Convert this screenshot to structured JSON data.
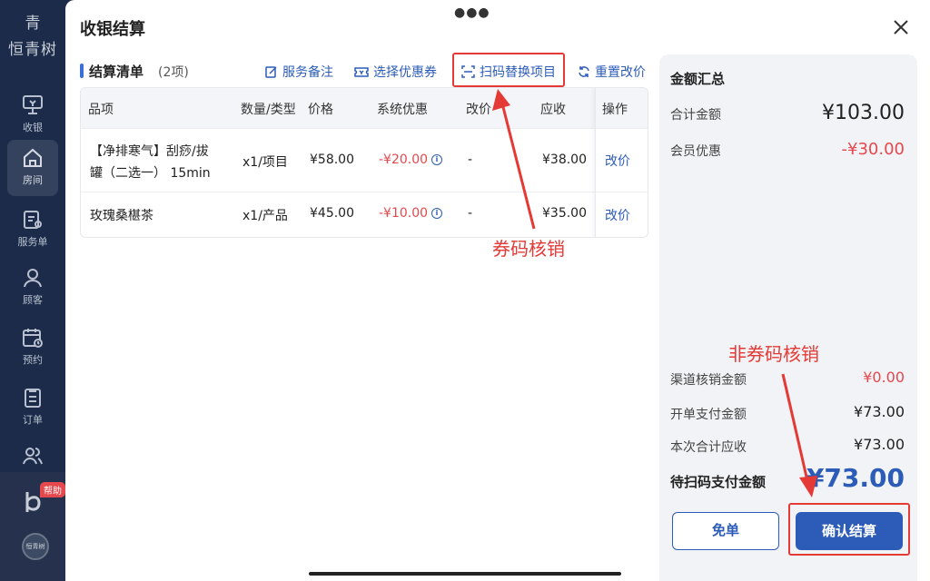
{
  "app": {
    "logo_mark": "青",
    "logo_text": "恒青树",
    "bottom_logo_text": "恒青树"
  },
  "sidebar": {
    "items": [
      {
        "label": "收银",
        "icon": "cashier-icon",
        "active": false
      },
      {
        "label": "房间",
        "icon": "home-icon",
        "active": true
      },
      {
        "label": "服务单",
        "icon": "service-order-icon",
        "active": false
      },
      {
        "label": "顾客",
        "icon": "customer-icon",
        "active": false
      },
      {
        "label": "预约",
        "icon": "calendar-icon",
        "active": false
      },
      {
        "label": "订单",
        "icon": "order-icon",
        "active": false
      },
      {
        "label": "",
        "icon": "users-icon",
        "active": false
      }
    ],
    "help_badge": "帮助"
  },
  "dialog": {
    "title": "收银结算"
  },
  "list": {
    "title": "结算清单",
    "count": "(2项)",
    "actions": {
      "remark": "服务备注",
      "coupon": "选择优惠券",
      "scan": "扫码替换项目",
      "reset": "重置改价"
    },
    "headers": [
      "品项",
      "数量/类型",
      "价格",
      "系统优惠",
      "改价",
      "应收",
      "操作"
    ],
    "rows": [
      {
        "name_line1": "【净排寒气】刮痧/拔",
        "name_line2": "罐（二选一） 15min",
        "qty": "x1/项目",
        "price": "¥58.00",
        "discount": "-¥20.00",
        "adjust": "-",
        "receivable": "¥38.00",
        "op": "改价"
      },
      {
        "name_line1": "玫瑰桑椹茶",
        "name_line2": "",
        "qty": "x1/产品",
        "price": "¥45.00",
        "discount": "-¥10.00",
        "adjust": "-",
        "receivable": "¥35.00",
        "op": "改价"
      }
    ]
  },
  "summary": {
    "title": "金额汇总",
    "total_label": "合计金额",
    "total_value": "¥103.00",
    "member_label": "会员优惠",
    "member_value": "-¥30.00",
    "channel_label": "渠道核销金额",
    "channel_value": "¥0.00",
    "paid_label": "开单支付金额",
    "paid_value": "¥73.00",
    "receivable_label": "本次合计应收",
    "receivable_value": "¥73.00",
    "pending_label": "待扫码支付金额",
    "pending_value": "¥73.00",
    "free_button": "免单",
    "confirm_button": "确认结算"
  },
  "annotations": {
    "coupon_verify": "券码核销",
    "non_coupon_verify": "非券码核销"
  },
  "colors": {
    "accent": "#2c5cb8",
    "sidebar_bg": "#1c2b49",
    "discount_red": "#e5484d",
    "annotation_red": "#e53935"
  }
}
